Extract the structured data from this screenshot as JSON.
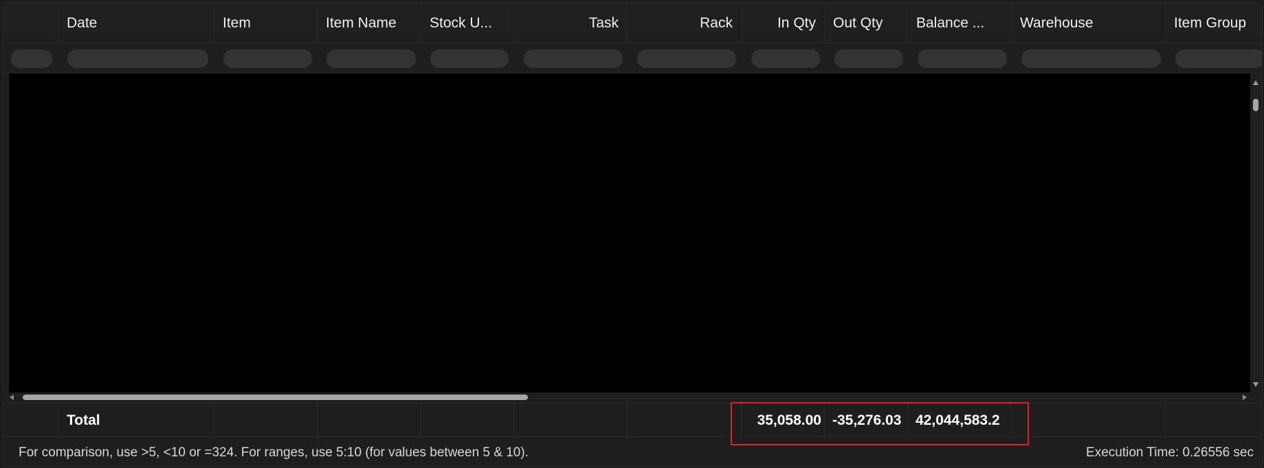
{
  "columns": [
    {
      "key": "index",
      "label": ""
    },
    {
      "key": "date",
      "label": "Date"
    },
    {
      "key": "item",
      "label": "Item"
    },
    {
      "key": "item_name",
      "label": "Item Name"
    },
    {
      "key": "stock_uom",
      "label": "Stock U..."
    },
    {
      "key": "task",
      "label": "Task"
    },
    {
      "key": "rack",
      "label": "Rack"
    },
    {
      "key": "in_qty",
      "label": "In Qty"
    },
    {
      "key": "out_qty",
      "label": "Out Qty"
    },
    {
      "key": "balance",
      "label": "Balance ..."
    },
    {
      "key": "warehouse",
      "label": "Warehouse"
    },
    {
      "key": "item_group",
      "label": "Item Group"
    }
  ],
  "totals": {
    "label": "Total",
    "in_qty": "35,058.00",
    "out_qty": "-35,276.03",
    "balance": "42,044,583.2"
  },
  "footer": {
    "hint": "For comparison, use >5, <10 or =324. For ranges, use 5:10 (for values between 5 & 10).",
    "execution_time": "Execution Time: 0.26556 sec"
  },
  "colors": {
    "highlight": "#e0202a",
    "background": "#1e1e1e",
    "grid_body": "#000000"
  }
}
